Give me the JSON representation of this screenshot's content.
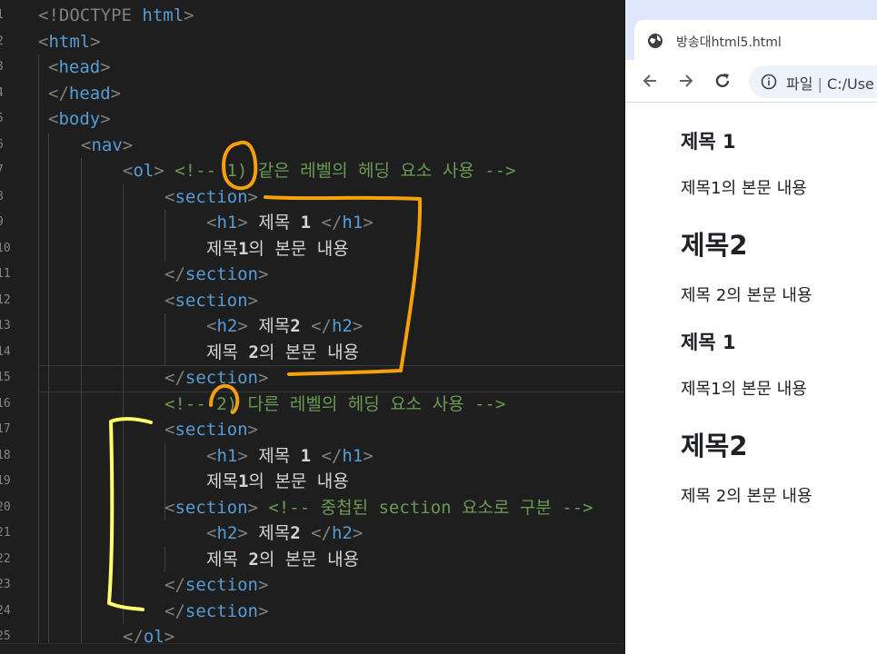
{
  "editor": {
    "gutter": [
      "1",
      "2",
      "3",
      "4",
      "5",
      "6",
      "7",
      "8",
      "9",
      "10",
      "11",
      "12",
      "13",
      "14",
      "15",
      "16",
      "17",
      "18",
      "19",
      "20",
      "21",
      "22",
      "23",
      "24",
      "25"
    ],
    "lines": [
      {
        "id": "doctype",
        "parts": [
          {
            "c": "t-tag",
            "t": "<!DOCTYPE "
          },
          {
            "c": "t-name",
            "t": "html"
          },
          {
            "c": "t-tag",
            "t": ">"
          }
        ]
      },
      {
        "id": "html-open",
        "parts": [
          {
            "c": "t-tag",
            "t": "<"
          },
          {
            "c": "t-name",
            "t": "html"
          },
          {
            "c": "t-tag",
            "t": ">"
          }
        ]
      },
      {
        "id": "head-open",
        "parts": [
          {
            "c": "t-tag",
            "t": "<"
          },
          {
            "c": "t-name",
            "t": "head"
          },
          {
            "c": "t-tag",
            "t": ">"
          }
        ]
      },
      {
        "id": "head-close",
        "parts": [
          {
            "c": "t-tag",
            "t": "</"
          },
          {
            "c": "t-name",
            "t": "head"
          },
          {
            "c": "t-tag",
            "t": ">"
          }
        ]
      },
      {
        "id": "body-open",
        "parts": [
          {
            "c": "t-tag",
            "t": "<"
          },
          {
            "c": "t-name",
            "t": "body"
          },
          {
            "c": "t-tag",
            "t": ">"
          }
        ]
      },
      {
        "id": "nav-open",
        "parts": [
          {
            "c": "t-tag",
            "t": "<"
          },
          {
            "c": "t-name",
            "t": "nav"
          },
          {
            "c": "t-tag",
            "t": ">"
          }
        ]
      },
      {
        "id": "ol-open",
        "parts": [
          {
            "c": "t-tag",
            "t": "<"
          },
          {
            "c": "t-name",
            "t": "ol"
          },
          {
            "c": "t-tag",
            "t": "> "
          },
          {
            "c": "t-com",
            "t": "<!-- 1) 같은 레벨의 헤딩 요소 사용 -->"
          }
        ]
      },
      {
        "id": "section-1-open",
        "parts": [
          {
            "c": "t-tag",
            "t": "<"
          },
          {
            "c": "t-name",
            "t": "section"
          },
          {
            "c": "t-tag",
            "t": ">"
          }
        ]
      },
      {
        "id": "h1-1",
        "parts": [
          {
            "c": "t-tag",
            "t": "<"
          },
          {
            "c": "t-name",
            "t": "h1"
          },
          {
            "c": "t-tag",
            "t": "> "
          },
          {
            "c": "t-text",
            "t": "제목 "
          },
          {
            "c": "t-bold",
            "t": "1"
          },
          {
            "c": "t-tag",
            "t": " </"
          },
          {
            "c": "t-name",
            "t": "h1"
          },
          {
            "c": "t-tag",
            "t": ">"
          }
        ]
      },
      {
        "id": "body-1",
        "parts": [
          {
            "c": "t-text",
            "t": "제목"
          },
          {
            "c": "t-bold",
            "t": "1"
          },
          {
            "c": "t-text",
            "t": "의 본문 내용"
          }
        ]
      },
      {
        "id": "section-1-close",
        "parts": [
          {
            "c": "t-tag",
            "t": "</"
          },
          {
            "c": "t-name",
            "t": "section"
          },
          {
            "c": "t-tag",
            "t": ">"
          }
        ]
      },
      {
        "id": "section-2-open",
        "parts": [
          {
            "c": "t-tag",
            "t": "<"
          },
          {
            "c": "t-name",
            "t": "section"
          },
          {
            "c": "t-tag",
            "t": ">"
          }
        ]
      },
      {
        "id": "h2-1",
        "parts": [
          {
            "c": "t-tag",
            "t": "<"
          },
          {
            "c": "t-name",
            "t": "h2"
          },
          {
            "c": "t-tag",
            "t": "> "
          },
          {
            "c": "t-text",
            "t": "제목"
          },
          {
            "c": "t-bold",
            "t": "2"
          },
          {
            "c": "t-tag",
            "t": " </"
          },
          {
            "c": "t-name",
            "t": "h2"
          },
          {
            "c": "t-tag",
            "t": ">"
          }
        ]
      },
      {
        "id": "body-2",
        "parts": [
          {
            "c": "t-text",
            "t": "제목 "
          },
          {
            "c": "t-bold",
            "t": "2"
          },
          {
            "c": "t-text",
            "t": "의 본문 내용"
          }
        ]
      },
      {
        "id": "section-2-close",
        "parts": [
          {
            "c": "t-tag",
            "t": "</"
          },
          {
            "c": "t-name",
            "t": "section"
          },
          {
            "c": "t-tag",
            "t": ">"
          }
        ]
      },
      {
        "id": "comment-2",
        "parts": [
          {
            "c": "t-com",
            "t": "<!-- 2) 다른 레벨의 헤딩 요소 사용 -->"
          }
        ]
      },
      {
        "id": "section-3-open",
        "parts": [
          {
            "c": "t-tag",
            "t": "<"
          },
          {
            "c": "t-name",
            "t": "section"
          },
          {
            "c": "t-tag",
            "t": ">"
          }
        ]
      },
      {
        "id": "h1-2",
        "parts": [
          {
            "c": "t-tag",
            "t": "<"
          },
          {
            "c": "t-name",
            "t": "h1"
          },
          {
            "c": "t-tag",
            "t": "> "
          },
          {
            "c": "t-text",
            "t": "제목 "
          },
          {
            "c": "t-bold",
            "t": "1"
          },
          {
            "c": "t-tag",
            "t": " </"
          },
          {
            "c": "t-name",
            "t": "h1"
          },
          {
            "c": "t-tag",
            "t": ">"
          }
        ]
      },
      {
        "id": "body-3",
        "parts": [
          {
            "c": "t-text",
            "t": "제목"
          },
          {
            "c": "t-bold",
            "t": "1"
          },
          {
            "c": "t-text",
            "t": "의 본문 내용"
          }
        ]
      },
      {
        "id": "section-4-open",
        "parts": [
          {
            "c": "t-tag",
            "t": "<"
          },
          {
            "c": "t-name",
            "t": "section"
          },
          {
            "c": "t-tag",
            "t": "> "
          },
          {
            "c": "t-com",
            "t": "<!-- 중첩된 section 요소로 구분 -->"
          }
        ]
      },
      {
        "id": "h2-2",
        "parts": [
          {
            "c": "t-tag",
            "t": "<"
          },
          {
            "c": "t-name",
            "t": "h2"
          },
          {
            "c": "t-tag",
            "t": "> "
          },
          {
            "c": "t-text",
            "t": "제목"
          },
          {
            "c": "t-bold",
            "t": "2"
          },
          {
            "c": "t-tag",
            "t": " </"
          },
          {
            "c": "t-name",
            "t": "h2"
          },
          {
            "c": "t-tag",
            "t": ">"
          }
        ]
      },
      {
        "id": "body-4",
        "parts": [
          {
            "c": "t-text",
            "t": "제목 "
          },
          {
            "c": "t-bold",
            "t": "2"
          },
          {
            "c": "t-text",
            "t": "의 본문 내용"
          }
        ]
      },
      {
        "id": "section-4-close",
        "parts": [
          {
            "c": "t-tag",
            "t": "</"
          },
          {
            "c": "t-name",
            "t": "section"
          },
          {
            "c": "t-tag",
            "t": ">"
          }
        ]
      },
      {
        "id": "section-3-close",
        "parts": [
          {
            "c": "t-tag",
            "t": "</"
          },
          {
            "c": "t-name",
            "t": "section"
          },
          {
            "c": "t-tag",
            "t": ">"
          }
        ]
      },
      {
        "id": "ol-close",
        "parts": [
          {
            "c": "t-tag",
            "t": "</"
          },
          {
            "c": "t-name",
            "t": "ol"
          },
          {
            "c": "t-tag",
            "t": ">"
          }
        ]
      }
    ],
    "annotation_colors": {
      "orange": "#f5a00c",
      "yellow": "#ffff6e"
    }
  },
  "browser": {
    "tab_title": "방송대html5.html",
    "tab_icon": "globe-icon",
    "back_icon": "arrow-left-icon",
    "forward_icon": "arrow-right-icon",
    "reload_icon": "reload-icon",
    "info_icon": "info-icon",
    "omnibox_label": "파일",
    "omnibox_separator": "|",
    "omnibox_path": "C:/Use",
    "page": [
      {
        "kind": "h1",
        "text": "제목 1"
      },
      {
        "kind": "p",
        "text": "제목1의 본문 내용"
      },
      {
        "kind": "h2",
        "text": "제목2"
      },
      {
        "kind": "p",
        "text": "제목 2의 본문 내용"
      },
      {
        "kind": "h1",
        "text": "제목 1"
      },
      {
        "kind": "p",
        "text": "제목1의 본문 내용"
      },
      {
        "kind": "h2",
        "text": "제목2"
      },
      {
        "kind": "p",
        "text": "제목 2의 본문 내용"
      }
    ]
  }
}
